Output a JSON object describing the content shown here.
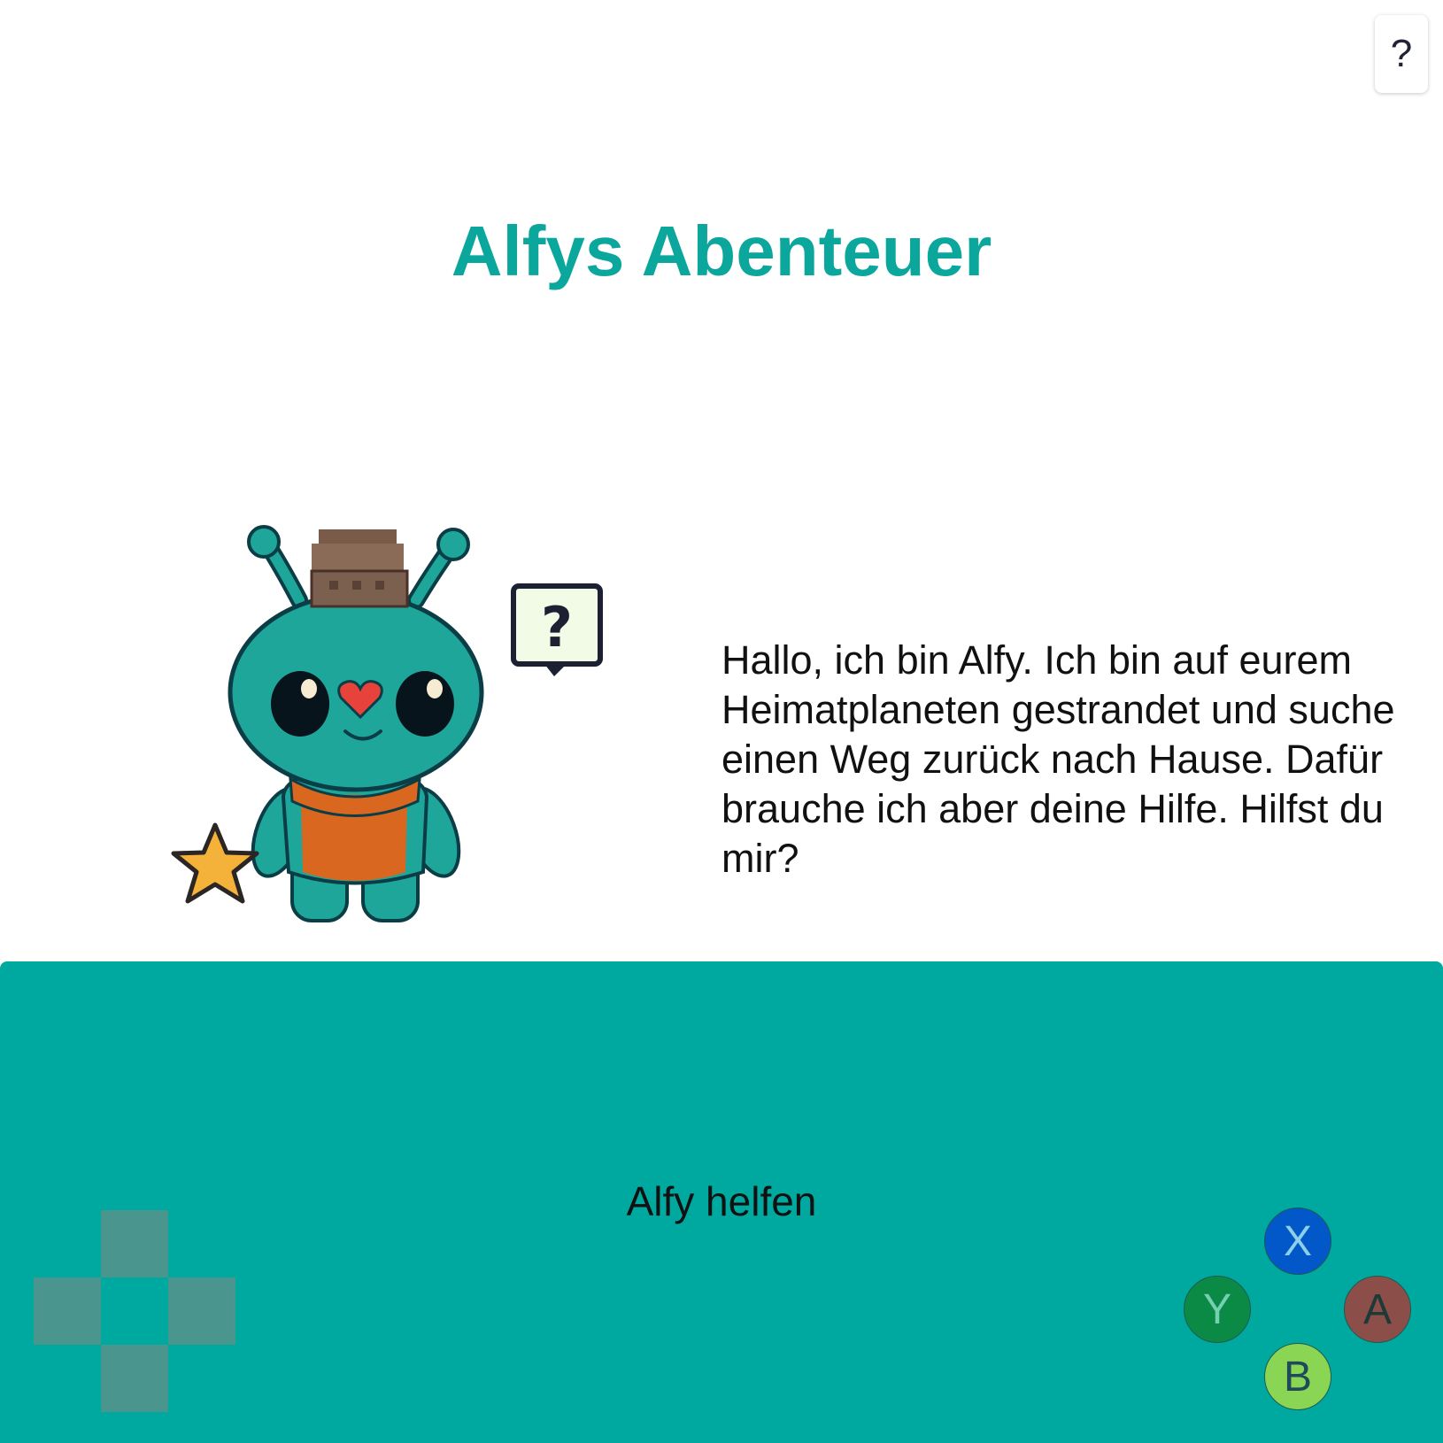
{
  "help": {
    "label": "?"
  },
  "title": "Alfys Abenteuer",
  "story": {
    "text": "Hallo, ich bin Alfy. Ich bin auf eurem Heimatplaneten gestrandet und suche einen Weg zurück nach Hause. Dafür brauche ich aber deine Hilfe. Hilfst du mir?"
  },
  "character": {
    "name": "alien-alfy",
    "icons": [
      "question-speech-bubble-icon",
      "star-icon"
    ]
  },
  "controller": {
    "action_label": "Alfy helfen",
    "buttons": {
      "x": {
        "label": "X",
        "color": "#0257c9",
        "text_color": "#8ccfe8"
      },
      "y": {
        "label": "Y",
        "color": "#0b8a45",
        "text_color": "#74d0b0"
      },
      "a": {
        "label": "A",
        "color": "#8b4e48",
        "text_color": "#1e3a38"
      },
      "b": {
        "label": "B",
        "color": "#8ad554",
        "text_color": "#1e4a5a"
      }
    }
  },
  "colors": {
    "accent": "#0ba79d",
    "panel": "#00a99f",
    "dpad": "#4a968e"
  }
}
